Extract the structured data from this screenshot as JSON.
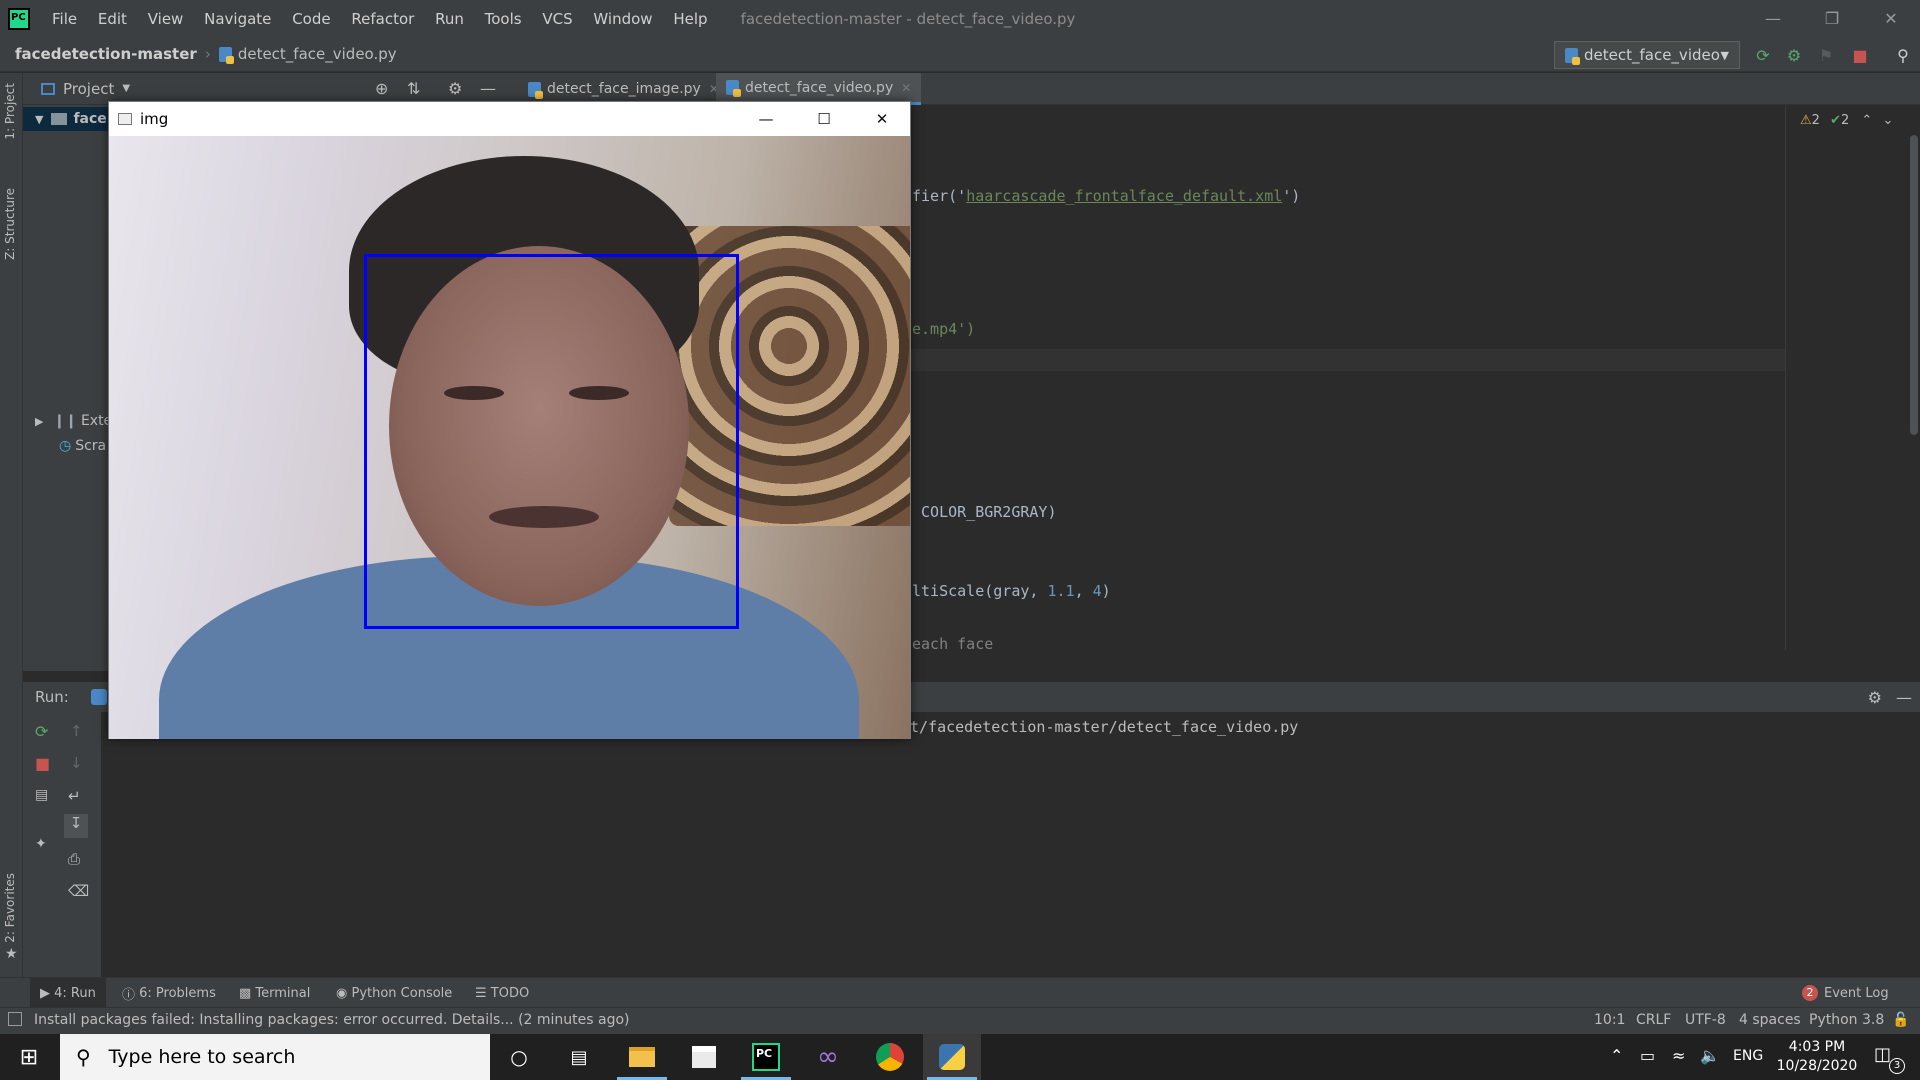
{
  "app": {
    "menu": [
      "File",
      "Edit",
      "View",
      "Navigate",
      "Code",
      "Refactor",
      "Run",
      "Tools",
      "VCS",
      "Window",
      "Help"
    ],
    "window_title": "facedetection-master - detect_face_video.py"
  },
  "navbar": {
    "project": "facedetection-master",
    "file": "detect_face_video.py",
    "run_config": "detect_face_video"
  },
  "side_tabs": {
    "project": "1: Project",
    "structure": "Z: Structure",
    "favorites": "2: Favorites"
  },
  "project_panel": {
    "title": "Project",
    "root": "face",
    "external": "Exte",
    "scratches": "Scra"
  },
  "editor": {
    "tabs": [
      {
        "label": "detect_face_image.py"
      },
      {
        "label": "detect_face_video.py",
        "active": true
      }
    ],
    "inspections": {
      "warnings": "2",
      "ok": "2"
    },
    "lines": {
      "l1_pre": "fier('",
      "l1_s1": "haarcascade",
      "l1_s2": "_",
      "l1_s3": "frontalface",
      "l1_s4": "_default.xml",
      "l1_post": "')",
      "l2": "e.mp4')",
      "l3": " COLOR_BGR2GRAY)",
      "l4_pre": "ltiScale(gray, ",
      "l4_n1": "1.1",
      ",": ", ",
      "l4_n2": "4",
      "l4_post": ")",
      "l5": "each face"
    }
  },
  "run": {
    "label": "Run:",
    "console_line": "t/facedetection-master/detect_face_video.py"
  },
  "bottom_tabs": {
    "run": "4: Run",
    "problems": "6: Problems",
    "terminal": "Terminal",
    "python_console": "Python Console",
    "todo": "TODO",
    "event_log": "Event Log",
    "event_count": "2"
  },
  "status": {
    "message": "Install packages failed: Installing packages: error occurred. Details... (2 minutes ago)",
    "position": "10:1",
    "line_sep": "CRLF",
    "encoding": "UTF-8",
    "indent": "4 spaces",
    "interpreter": "Python 3.8"
  },
  "img_window": {
    "title": "img"
  },
  "taskbar": {
    "search_placeholder": "Type here to search",
    "lang": "ENG",
    "time": "4:03 PM",
    "date": "10/28/2020",
    "notifications": "3"
  },
  "colors": {
    "face_box": "#0000ff",
    "ide_bg": "#2b2b2b",
    "panel": "#3c3f41"
  }
}
